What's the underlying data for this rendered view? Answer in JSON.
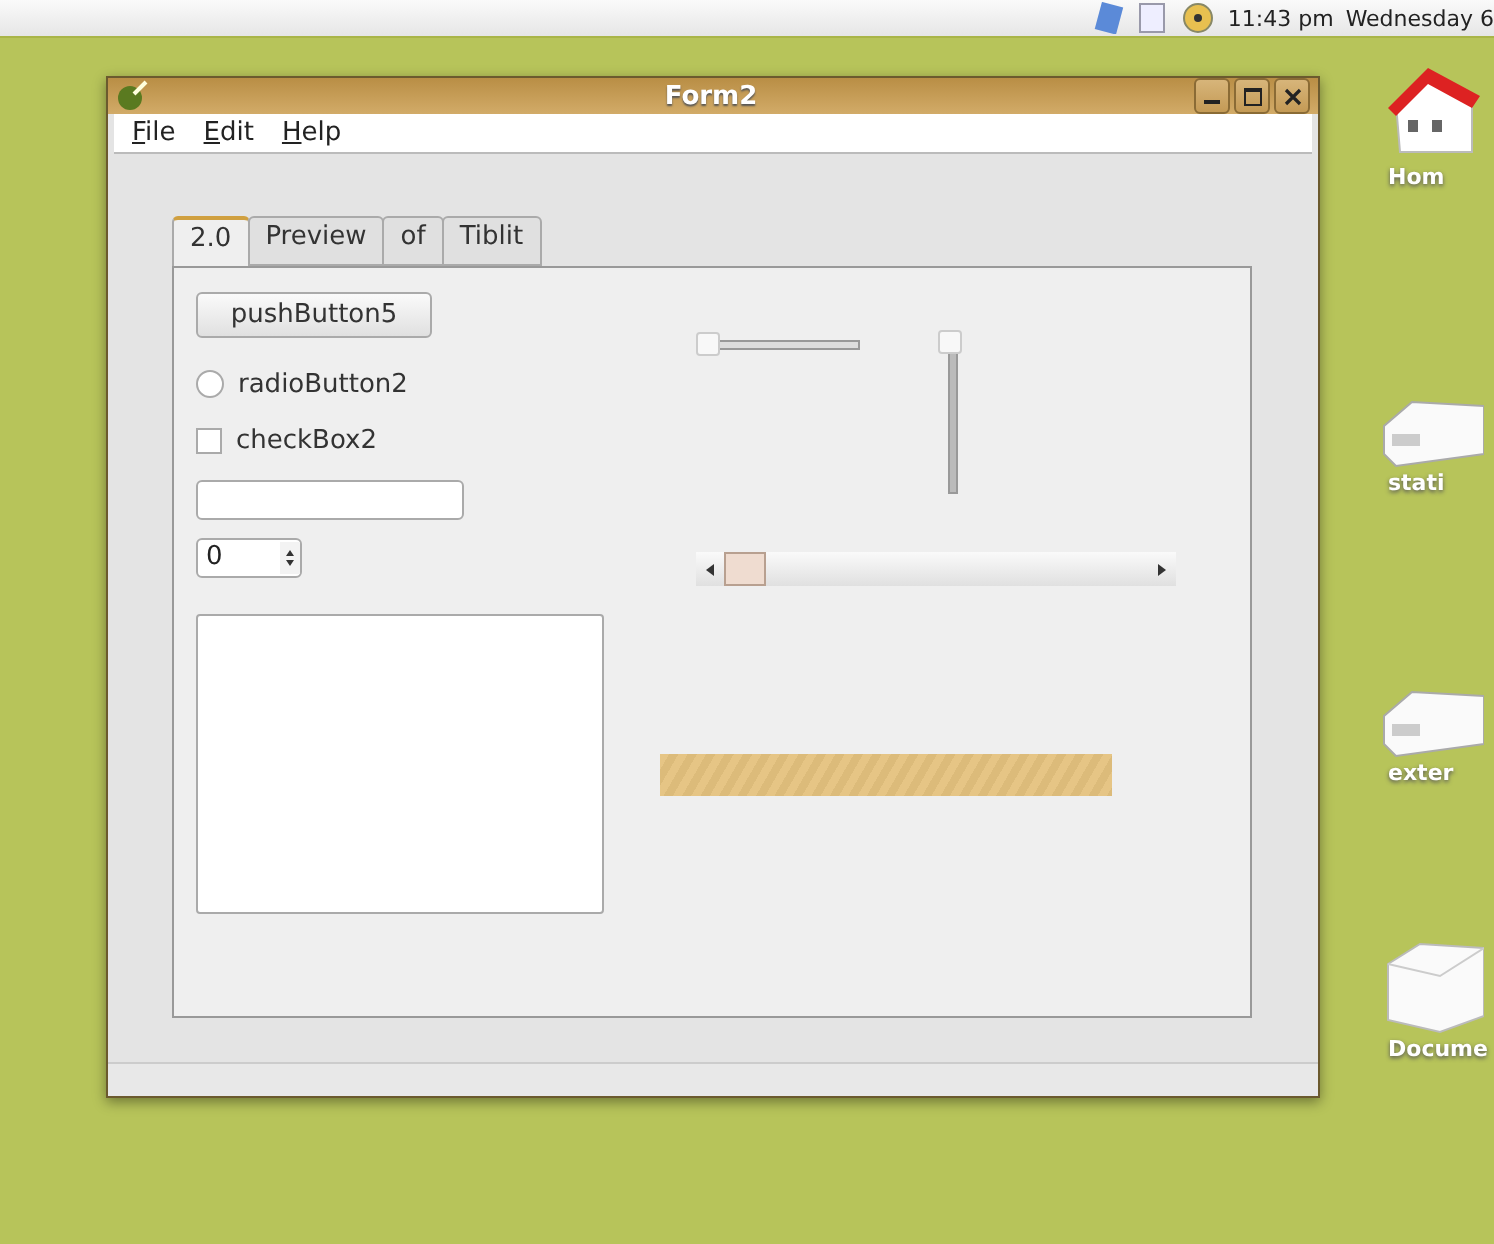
{
  "top_panel": {
    "clock": "11:43 pm",
    "date": "Wednesday 6"
  },
  "desktop_icons": [
    {
      "label": "Hom",
      "kind": "house"
    },
    {
      "label": "stati",
      "kind": "drive"
    },
    {
      "label": "exter",
      "kind": "drive"
    },
    {
      "label": "Docume",
      "kind": "box"
    }
  ],
  "window": {
    "title": "Form2"
  },
  "menu": [
    {
      "label": "File"
    },
    {
      "label": "Edit"
    },
    {
      "label": "Help"
    }
  ],
  "tabs": [
    {
      "label": "2.0",
      "selected": true
    },
    {
      "label": "Preview",
      "selected": false
    },
    {
      "label": "of",
      "selected": false
    },
    {
      "label": "Tiblit",
      "selected": false
    }
  ],
  "push_button": "pushButton5",
  "radio": {
    "label": "radioButton2",
    "checked": false
  },
  "checkbox": {
    "label": "checkBox2",
    "checked": false
  },
  "spin": {
    "value": "0"
  },
  "h_slider": {
    "level": 0
  },
  "v_slider": {
    "level": 1
  },
  "progress": {
    "level": 1
  }
}
